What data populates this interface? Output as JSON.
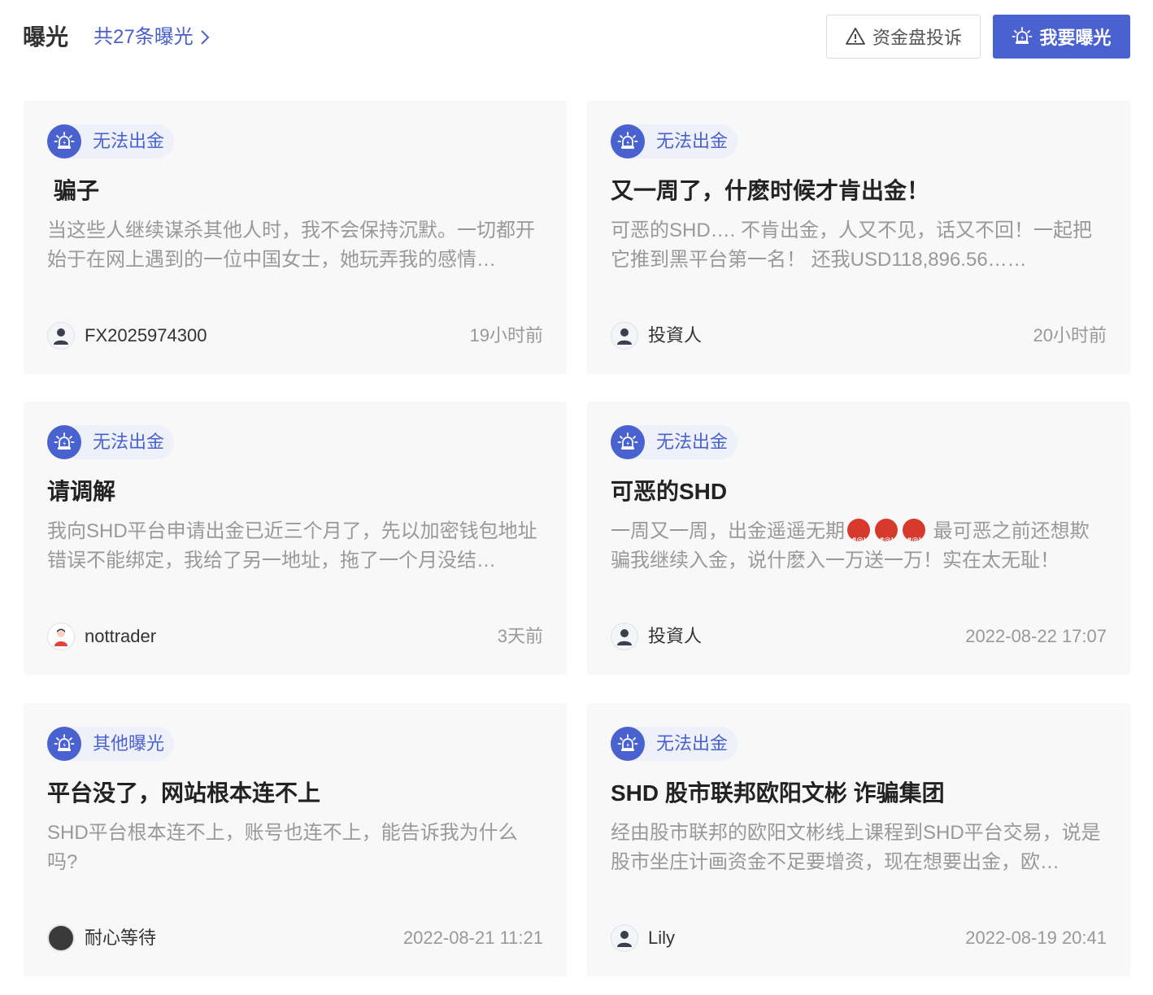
{
  "header": {
    "title": "曝光",
    "total_text": "共27条曝光",
    "complain_button": "资金盘投诉",
    "expose_button": "我要曝光"
  },
  "colors": {
    "accent": "#4a62d0",
    "tag_bg": "#eef0fa",
    "card_bg": "#f8f8f9"
  },
  "cards": [
    {
      "tag": "无法出金",
      "title": "骗子",
      "body": "当这些人继续谋杀其他人时，我不会保持沉默。一切都开始于在网上遇到的一位中国女士，她玩弄我的感情…",
      "author": "FX2025974300",
      "time": "19小时前",
      "avatar": "user-icon"
    },
    {
      "tag": "无法出金",
      "title": "又一周了，什麽时候才肯出金！",
      "body": "可恶的SHD…. 不肯出金，人又不见，话又不回！一起把它推到黑平台第一名！ 还我USD118,896.56……",
      "author": "投資人",
      "time": "20小时前",
      "avatar": "user-icon"
    },
    {
      "tag": "无法出金",
      "title": "请调解",
      "body": "我向SHD平台申请出金已近三个月了，先以加密钱包地址错误不能绑定，我给了另一地址，拖了一个月没结…",
      "author": "nottrader",
      "time": "3天前",
      "avatar": "person-icon"
    },
    {
      "tag": "无法出金",
      "title": "可恶的SHD",
      "body_before_emoji": "一周又一周，出金遥遥无期",
      "body_emoji": "angry-emoji",
      "body_after_emoji": " 最可恶之前还想欺骗我继续入金，说什麽入一万送一万！实在太无耻！",
      "author": "投資人",
      "time": "2022-08-22 17:07",
      "avatar": "user-icon"
    },
    {
      "tag": "其他曝光",
      "title": "平台没了，网站根本连不上",
      "body": "SHD平台根本连不上，账号也连不上，能告诉我为什么吗?",
      "author": "耐心等待",
      "time": "2022-08-21 11:21",
      "avatar": "dark-avatar"
    },
    {
      "tag": "无法出金",
      "title": "SHD 股市联邦欧阳文彬 诈骗集团",
      "body": "经由股市联邦的欧阳文彬线上课程到SHD平台交易，说是股市坐庄计画资金不足要增资，现在想要出金，欧…",
      "author": "Lily",
      "time": "2022-08-19 20:41",
      "avatar": "user-icon"
    }
  ]
}
